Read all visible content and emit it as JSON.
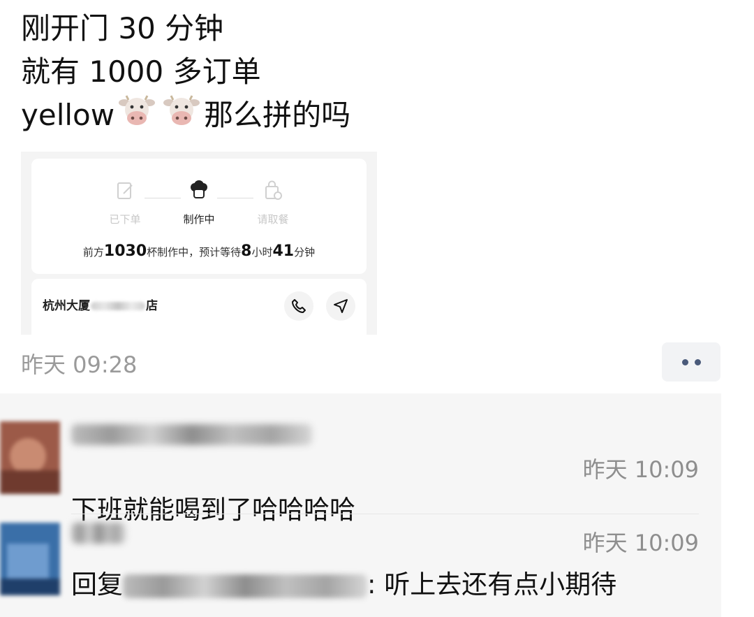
{
  "post": {
    "line1": "刚开门 30 分钟",
    "line2": "就有 1000 多订单",
    "line3_text": "yellow",
    "line3_emojis": [
      "cow-face-emoji",
      "cow-face-emoji"
    ],
    "line3_rest": "那么拼的吗",
    "time": "昨天 09:28"
  },
  "screenshot": {
    "steps": [
      {
        "label": "已下单",
        "icon": "order-placed-icon",
        "active": false
      },
      {
        "label": "制作中",
        "icon": "chef-hat-icon",
        "active": true
      },
      {
        "label": "请取餐",
        "icon": "pickup-bag-icon",
        "active": false
      }
    ],
    "wait": {
      "prefix": "前方",
      "cups": "1030",
      "middle": "杯制作中，预计等待",
      "hours": "8",
      "hours_unit": "小时",
      "minutes": "41",
      "minutes_unit": "分钟"
    },
    "store": {
      "name_start": "杭州大厦",
      "name_end": "店",
      "phone_icon": "phone-icon",
      "nav_icon": "navigation-icon"
    }
  },
  "more_button_icon": "more-dots-icon",
  "comments": [
    {
      "time": "昨天 10:09",
      "body": "下班就能喝到了哈哈哈哈"
    },
    {
      "time": "昨天 10:09",
      "reply_prefix": "回复",
      "reply_rest": ": 听上去还有点小期待"
    }
  ],
  "colors": {
    "comment_bg": "#f6f6f6",
    "more_dots": "#4a5a7a",
    "meta_gray": "#9a9a9a"
  }
}
